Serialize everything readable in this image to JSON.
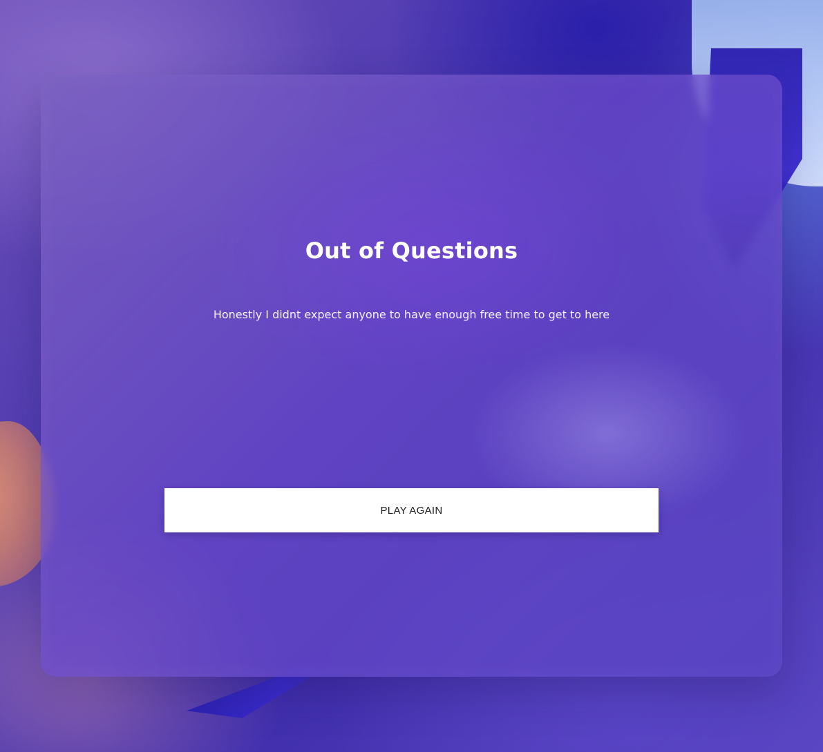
{
  "screen": {
    "title": "Out of Questions",
    "message": "Honestly I didnt expect anyone to have enough free time to get to here",
    "button_label": "PLAY AGAIN"
  },
  "theme": {
    "panel_tint": "#6d4fc8",
    "text_color": "#ffffff",
    "button_background": "#ffffff"
  }
}
